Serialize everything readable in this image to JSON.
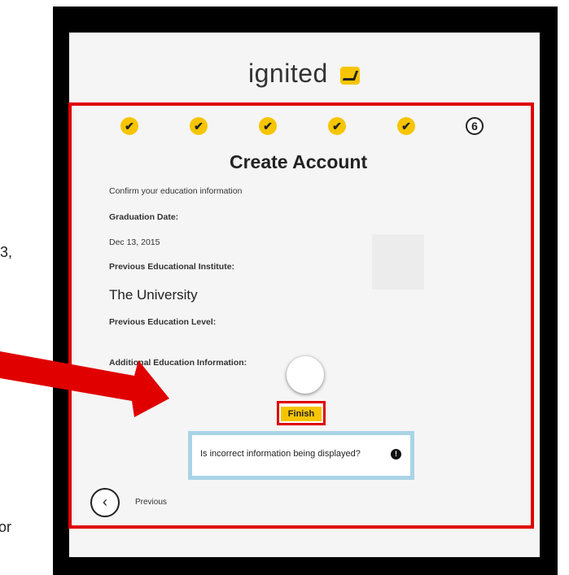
{
  "left_text": {
    "comma": "3,",
    "or": "or"
  },
  "logo": {
    "text": "ignited"
  },
  "steps": [
    {
      "state": "done",
      "glyph": "✔"
    },
    {
      "state": "done",
      "glyph": "✔"
    },
    {
      "state": "done",
      "glyph": "✔"
    },
    {
      "state": "done",
      "glyph": "✔"
    },
    {
      "state": "done",
      "glyph": "✔"
    },
    {
      "state": "current",
      "number": "6"
    }
  ],
  "form": {
    "title": "Create Account",
    "subtitle": "Confirm your education information",
    "graduation_label": "Graduation Date:",
    "graduation_value": "Dec 13, 2015",
    "institute_label": "Previous Educational Institute:",
    "institute_value": "The University",
    "level_label": "Previous Education Level:",
    "additional_label": "Additional Education Information:"
  },
  "buttons": {
    "finish": "Finish",
    "previous": "Previous"
  },
  "info": {
    "text": "Is incorrect information being displayed?",
    "icon": "!"
  },
  "icons": {
    "back": "‹"
  },
  "colors": {
    "accent": "#f6c500",
    "highlight_red": "#e00000",
    "info_border": "#a9d3e6"
  }
}
